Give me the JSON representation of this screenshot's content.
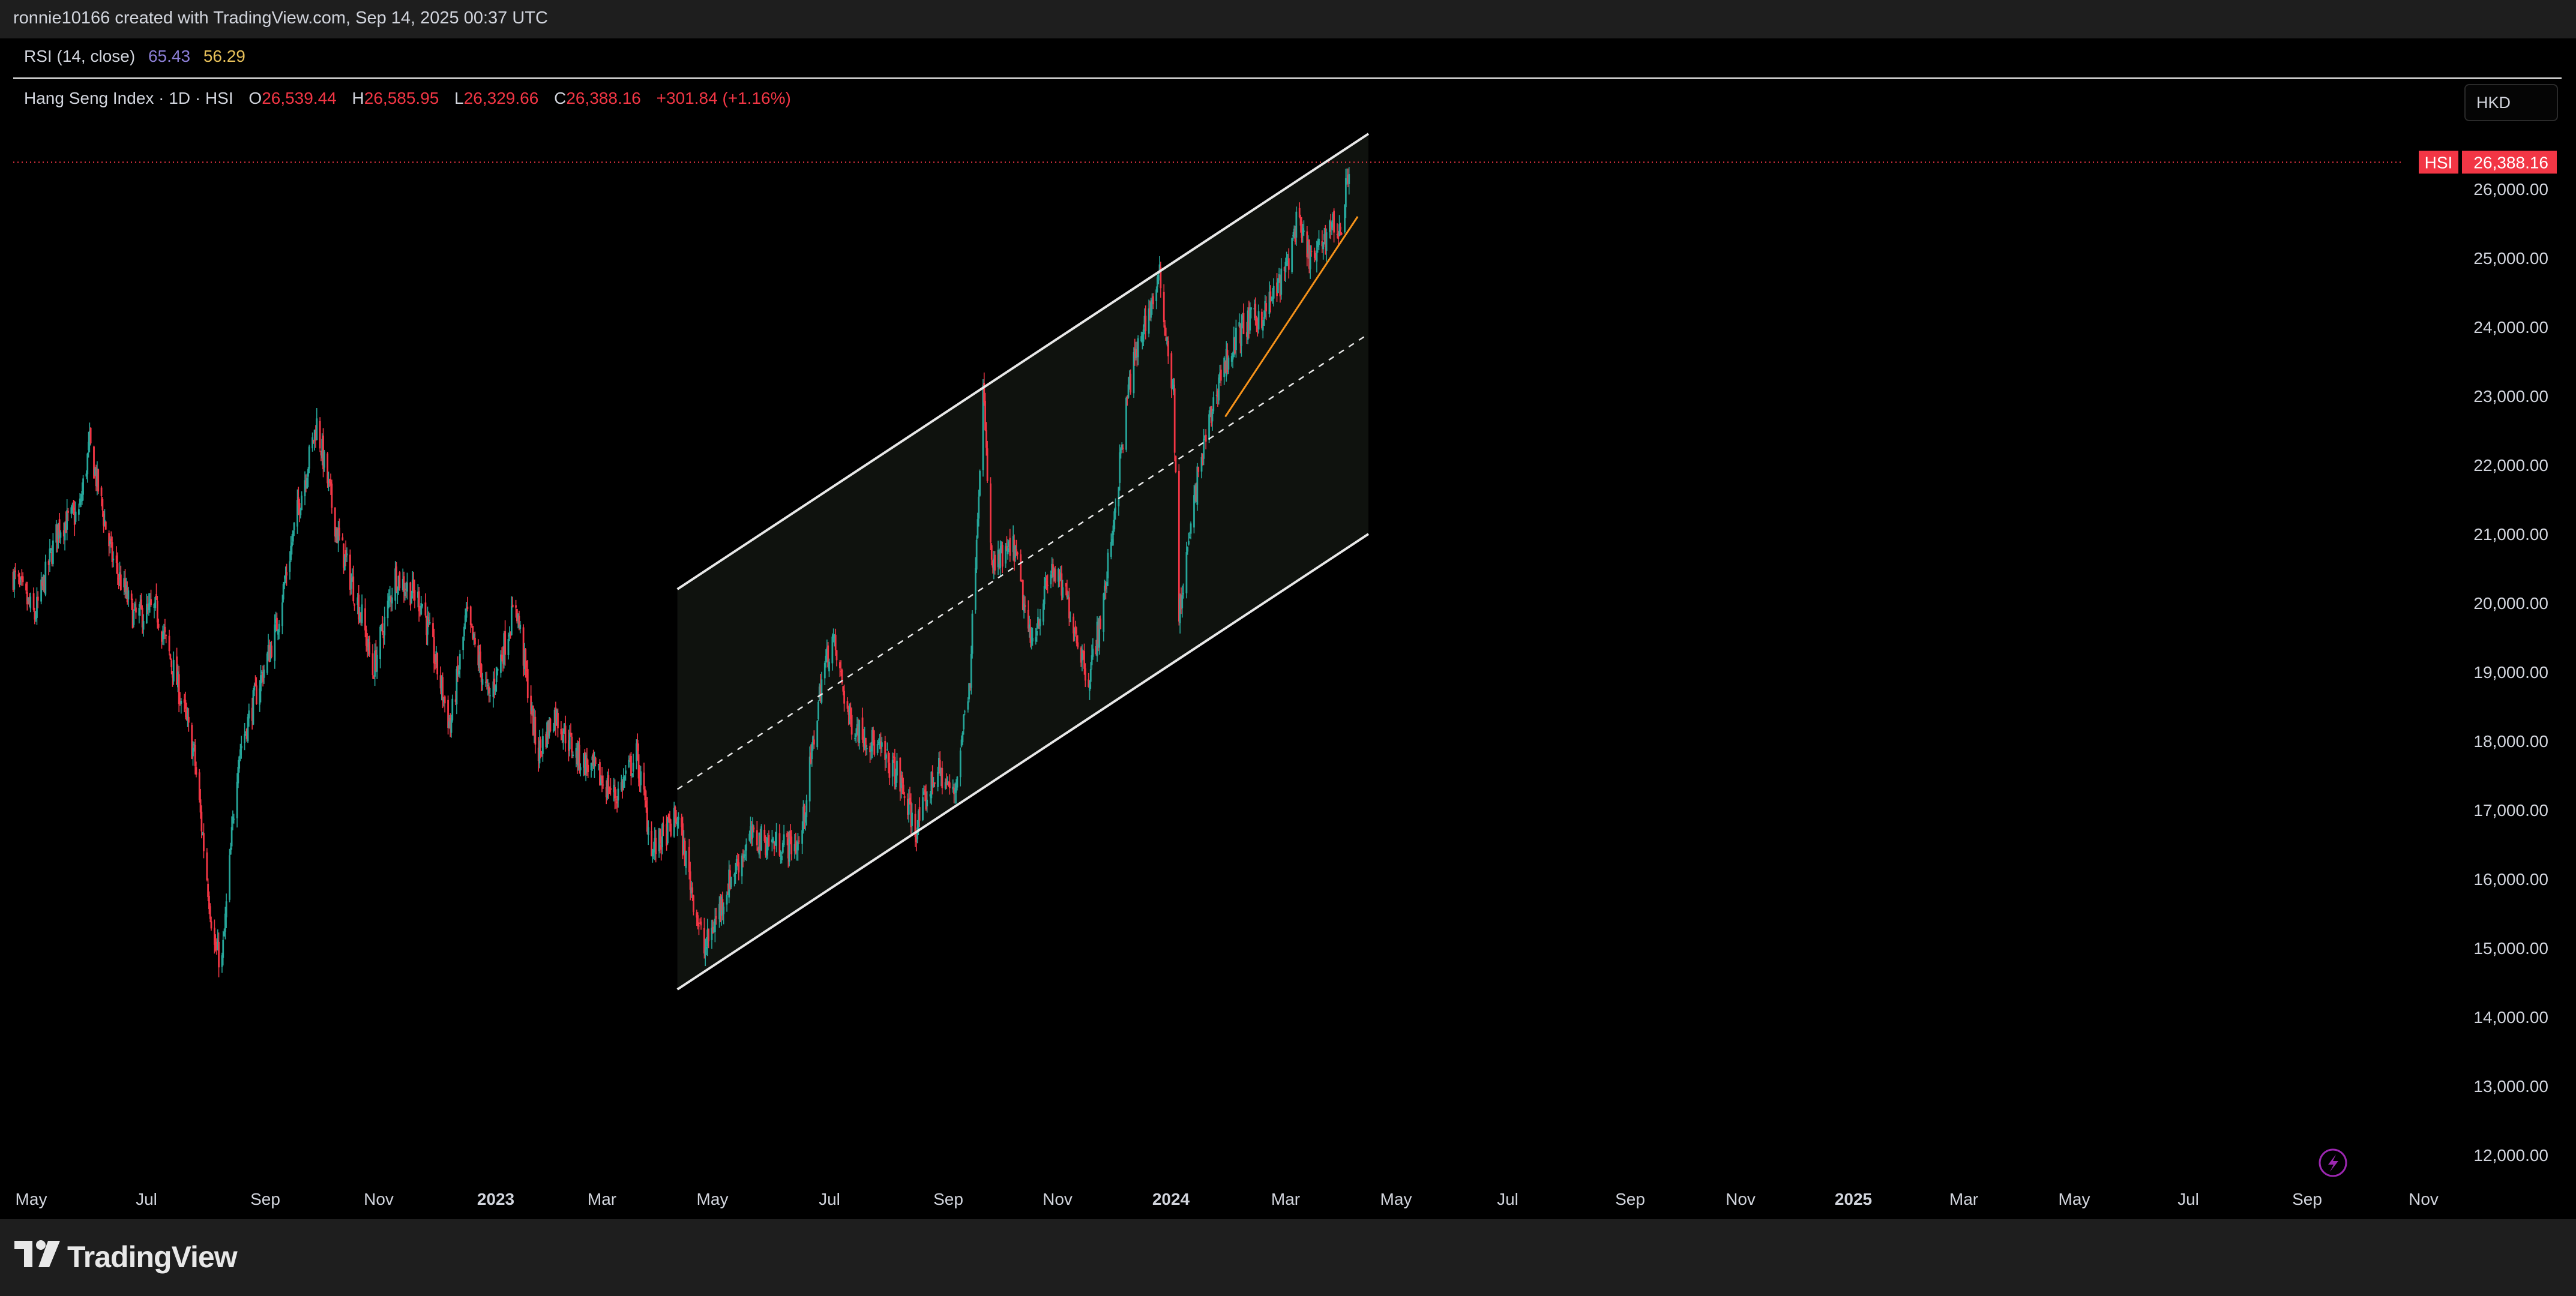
{
  "header": {
    "attribution": "ronnie10166 created with TradingView.com, Sep 14, 2025 00:37 UTC"
  },
  "rsi": {
    "label": "RSI (14, close)",
    "value1": "65.43",
    "value2": "56.29"
  },
  "legend": {
    "title": "Hang Seng Index · 1D · HSI",
    "o_label": "O",
    "o_value": "26,539.44",
    "h_label": "H",
    "h_value": "26,585.95",
    "l_label": "L",
    "l_value": "26,329.66",
    "c_label": "C",
    "c_value": "26,388.16",
    "change": "+301.84 (+1.16%)"
  },
  "currency": "HKD",
  "price_tag": {
    "symbol": "HSI",
    "value": "26,388.16"
  },
  "brand": "TradingView",
  "colors": {
    "up": "#26a69a",
    "down": "#f23645",
    "channel": "#e8e8e8",
    "trendline": "#f7931a",
    "background": "#000000",
    "toolbar": "#1e1e1e"
  },
  "chart_data": {
    "type": "candlestick",
    "instrument": "Hang Seng Index",
    "interval": "1D",
    "x_ticks": [
      "May",
      "Jul",
      "Sep",
      "Nov",
      "2023",
      "Mar",
      "May",
      "Jul",
      "Sep",
      "Nov",
      "2024",
      "Mar",
      "May",
      "Jul",
      "Sep",
      "Nov",
      "2025",
      "Mar",
      "May",
      "Jul",
      "Sep",
      "Nov"
    ],
    "y_ticks": [
      "26,000.00",
      "25,000.00",
      "24,000.00",
      "23,000.00",
      "22,000.00",
      "21,000.00",
      "20,000.00",
      "19,000.00",
      "18,000.00",
      "17,000.00",
      "16,000.00",
      "15,000.00",
      "14,000.00",
      "13,000.00",
      "12,000.00"
    ],
    "ylim": [
      11700,
      26900
    ],
    "last_close": 26388.16,
    "close_path": [
      {
        "date": "2022-04-20",
        "close": 20400
      },
      {
        "date": "2022-05-10",
        "close": 19800
      },
      {
        "date": "2022-06-01",
        "close": 21100
      },
      {
        "date": "2022-06-20",
        "close": 21300
      },
      {
        "date": "2022-06-30",
        "close": 22300
      },
      {
        "date": "2022-07-20",
        "close": 20700
      },
      {
        "date": "2022-08-10",
        "close": 19800
      },
      {
        "date": "2022-08-31",
        "close": 19900
      },
      {
        "date": "2022-09-20",
        "close": 18800
      },
      {
        "date": "2022-10-05",
        "close": 17800
      },
      {
        "date": "2022-10-24",
        "close": 15000
      },
      {
        "date": "2022-10-31",
        "close": 14800
      },
      {
        "date": "2022-11-15",
        "close": 17800
      },
      {
        "date": "2022-11-30",
        "close": 18600
      },
      {
        "date": "2022-12-20",
        "close": 19600
      },
      {
        "date": "2023-01-10",
        "close": 21400
      },
      {
        "date": "2023-01-27",
        "close": 22600
      },
      {
        "date": "2023-02-15",
        "close": 21000
      },
      {
        "date": "2023-03-10",
        "close": 19800
      },
      {
        "date": "2023-03-20",
        "close": 19000
      },
      {
        "date": "2023-04-10",
        "close": 20400
      },
      {
        "date": "2023-05-05",
        "close": 20000
      },
      {
        "date": "2023-05-31",
        "close": 18200
      },
      {
        "date": "2023-06-15",
        "close": 19800
      },
      {
        "date": "2023-07-06",
        "close": 18600
      },
      {
        "date": "2023-07-31",
        "close": 20000
      },
      {
        "date": "2023-08-20",
        "close": 17800
      },
      {
        "date": "2023-09-05",
        "close": 18400
      },
      {
        "date": "2023-09-25",
        "close": 17800
      },
      {
        "date": "2023-10-15",
        "close": 17500
      },
      {
        "date": "2023-11-01",
        "close": 17200
      },
      {
        "date": "2023-11-20",
        "close": 17800
      },
      {
        "date": "2023-12-05",
        "close": 16400
      },
      {
        "date": "2023-12-28",
        "close": 16900
      },
      {
        "date": "2024-01-22",
        "close": 14950
      },
      {
        "date": "2024-02-15",
        "close": 16000
      },
      {
        "date": "2024-03-05",
        "close": 16600
      },
      {
        "date": "2024-04-01",
        "close": 16500
      },
      {
        "date": "2024-04-20",
        "close": 16500
      },
      {
        "date": "2024-05-10",
        "close": 18900
      },
      {
        "date": "2024-05-20",
        "close": 19500
      },
      {
        "date": "2024-06-05",
        "close": 18300
      },
      {
        "date": "2024-06-25",
        "close": 18000
      },
      {
        "date": "2024-07-20",
        "close": 17500
      },
      {
        "date": "2024-08-05",
        "close": 16700
      },
      {
        "date": "2024-08-25",
        "close": 17600
      },
      {
        "date": "2024-09-10",
        "close": 17200
      },
      {
        "date": "2024-09-25",
        "close": 19000
      },
      {
        "date": "2024-10-07",
        "close": 23100
      },
      {
        "date": "2024-10-15",
        "close": 20500
      },
      {
        "date": "2024-11-05",
        "close": 20800
      },
      {
        "date": "2024-11-20",
        "close": 19400
      },
      {
        "date": "2024-12-10",
        "close": 20500
      },
      {
        "date": "2024-12-25",
        "close": 20000
      },
      {
        "date": "2025-01-13",
        "close": 18900
      },
      {
        "date": "2025-01-27",
        "close": 20000
      },
      {
        "date": "2025-02-20",
        "close": 23200
      },
      {
        "date": "2025-03-05",
        "close": 24000
      },
      {
        "date": "2025-03-20",
        "close": 24700
      },
      {
        "date": "2025-04-02",
        "close": 23000
      },
      {
        "date": "2025-04-07",
        "close": 19800
      },
      {
        "date": "2025-04-25",
        "close": 21900
      },
      {
        "date": "2025-05-15",
        "close": 23300
      },
      {
        "date": "2025-06-05",
        "close": 24000
      },
      {
        "date": "2025-06-25",
        "close": 24200
      },
      {
        "date": "2025-07-15",
        "close": 24800
      },
      {
        "date": "2025-07-25",
        "close": 25500
      },
      {
        "date": "2025-08-10",
        "close": 24900
      },
      {
        "date": "2025-08-25",
        "close": 25500
      },
      {
        "date": "2025-09-05",
        "close": 25400
      },
      {
        "date": "2025-09-12",
        "close": 26388.16
      }
    ],
    "annotations": {
      "channel_upper": [
        {
          "date": "2023-12-28",
          "price": 20200
        },
        {
          "date": "2025-09-30",
          "price": 26800
        }
      ],
      "channel_lower": [
        {
          "date": "2023-12-28",
          "price": 14400
        },
        {
          "date": "2025-09-30",
          "price": 21000
        }
      ],
      "channel_midline": [
        {
          "date": "2023-12-28",
          "price": 17300
        },
        {
          "date": "2025-09-30",
          "price": 23900
        }
      ],
      "trendline": [
        {
          "date": "2025-05-20",
          "price": 22700
        },
        {
          "date": "2025-09-20",
          "price": 25600
        }
      ]
    }
  }
}
